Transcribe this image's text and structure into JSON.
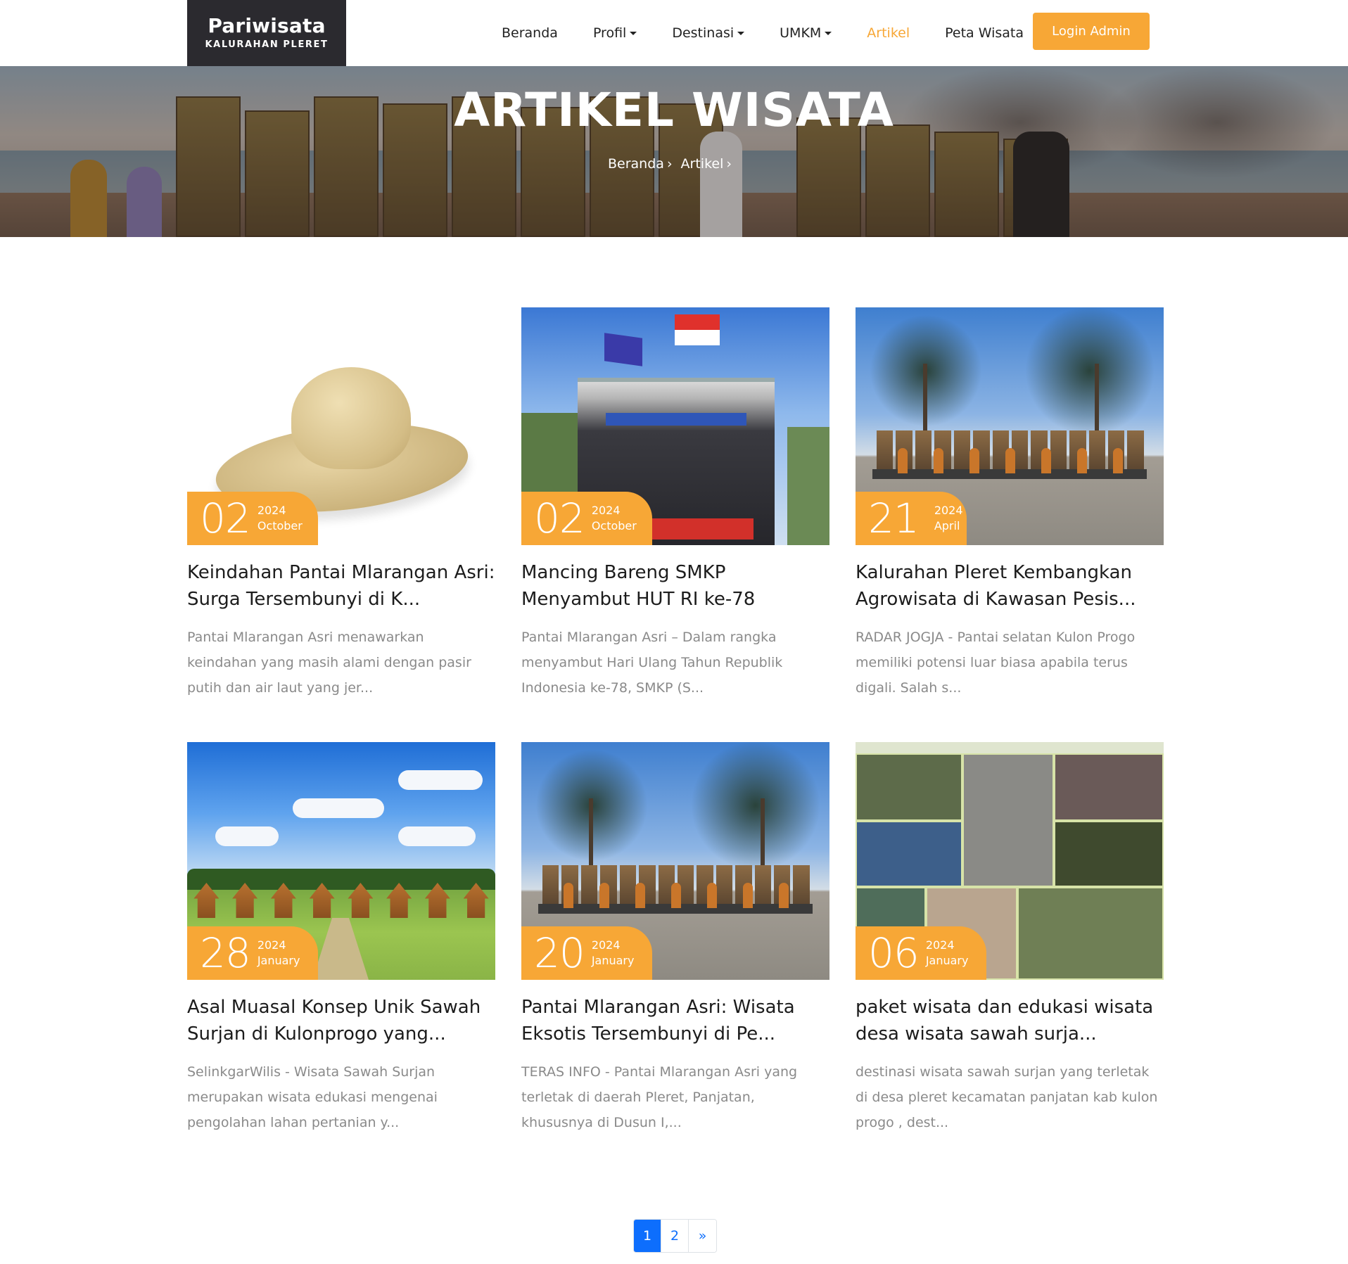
{
  "brand": {
    "title": "Pariwisata",
    "subtitle": "KALURAHAN PLERET"
  },
  "nav": {
    "items": [
      {
        "label": "Beranda",
        "dropdown": false,
        "active": false
      },
      {
        "label": "Profil",
        "dropdown": true,
        "active": false
      },
      {
        "label": "Destinasi",
        "dropdown": true,
        "active": false
      },
      {
        "label": "UMKM",
        "dropdown": true,
        "active": false
      },
      {
        "label": "Artikel",
        "dropdown": false,
        "active": true
      },
      {
        "label": "Peta Wisata",
        "dropdown": false,
        "active": false
      }
    ],
    "login_label": "Login Admin"
  },
  "hero": {
    "title": "ARTIKEL WISATA",
    "breadcrumb": [
      "Beranda",
      "Artikel"
    ],
    "separator": "›"
  },
  "articles": [
    {
      "day": "02",
      "year": "2024",
      "month": "October",
      "title": "Keindahan Pantai Mlarangan Asri: Surga Tersembunyi di K...",
      "excerpt": "Pantai Mlarangan Asri menawarkan keindahan yang masih alami dengan pasir putih dan air laut yang jer...",
      "image": "straw-hat"
    },
    {
      "day": "02",
      "year": "2024",
      "month": "October",
      "title": "Mancing Bareng SMKP Menyambut HUT RI ke-78",
      "excerpt": "Pantai Mlarangan Asri – Dalam rangka menyambut Hari Ulang Tahun Republik Indonesia ke-78, SMKP (S...",
      "image": "event-stage"
    },
    {
      "day": "21",
      "year": "2024",
      "month": "April",
      "title": "Kalurahan Pleret Kembangkan Agrowisata di Kawasan Pesis...",
      "excerpt": "RADAR JOGJA - Pantai selatan Kulon Progo memiliki potensi luar biasa apabila terus digali. Salah s...",
      "image": "mlarangan-asri-sign"
    },
    {
      "day": "28",
      "year": "2024",
      "month": "January",
      "title": "Asal Muasal Konsep Unik Sawah Surjan di Kulonprogo yang...",
      "excerpt": "SelinkgarWilis - Wisata Sawah Surjan merupakan wisata edukasi mengenai pengolahan lahan pertanian y...",
      "image": "sawah-huts"
    },
    {
      "day": "20",
      "year": "2024",
      "month": "January",
      "title": "Pantai Mlarangan Asri: Wisata Eksotis Tersembunyi di Pe...",
      "excerpt": "TERAS INFO - Pantai Mlarangan Asri yang terletak di daerah Pleret, Panjatan, khususnya di Dusun I,...",
      "image": "mlarangan-asri-sign"
    },
    {
      "day": "06",
      "year": "2024",
      "month": "January",
      "title": "paket wisata dan edukasi wisata desa wisata sawah surja...",
      "excerpt": "destinasi wisata sawah surjan yang terletak di desa pleret kecamatan panjatan kab kulon progo , dest...",
      "image": "photo-collage"
    }
  ],
  "pagination": {
    "pages": [
      "1",
      "2"
    ],
    "next": "»",
    "current": "1"
  },
  "colors": {
    "accent": "#f7a736",
    "brand_bg": "#2b2a2f",
    "page_active": "#0d6efd",
    "excerpt": "#8a8a8a"
  }
}
